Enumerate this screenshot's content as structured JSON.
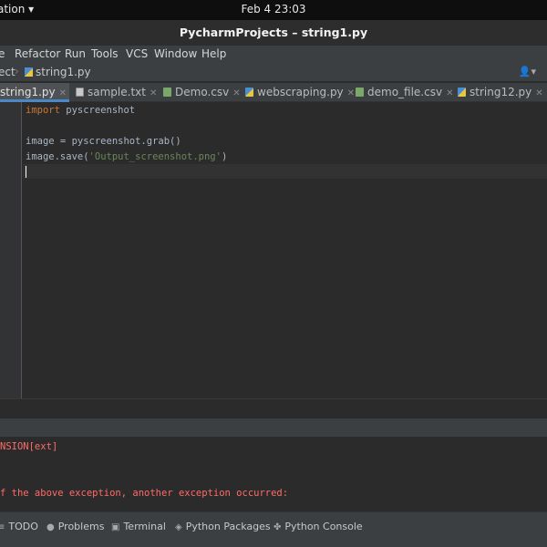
{
  "topbar": {
    "activities": "ation ▾",
    "clock": "Feb 4  23:03"
  },
  "window": {
    "title": "PycharmProjects – string1.py"
  },
  "menu": [
    "e",
    "Refactor",
    "Run",
    "Tools",
    "VCS",
    "Window",
    "Help"
  ],
  "breadcrumb": {
    "project": "ect",
    "file": "string1.py"
  },
  "tabs": [
    {
      "label": "string1.py",
      "active": true,
      "icon": "python-file-icon"
    },
    {
      "label": "sample.txt",
      "active": false,
      "icon": "text-file-icon"
    },
    {
      "label": "Demo.csv",
      "active": false,
      "icon": "csv-file-icon"
    },
    {
      "label": "webscraping.py",
      "active": false,
      "icon": "python-file-icon"
    },
    {
      "label": "demo_file.csv",
      "active": false,
      "icon": "csv-file-icon"
    },
    {
      "label": "string12.py",
      "active": false,
      "icon": "python-file-icon"
    }
  ],
  "code": {
    "l1_kw": "import",
    "l1_rest": " pyscreenshot",
    "l3": "image = pyscreenshot.grab()",
    "l4_pre": "image.save(",
    "l4_str": "'Output_screenshot.png'",
    "l4_post": ")"
  },
  "console": {
    "line1": "NSION[ext]",
    "line2": "f the above exception, another exception occurred:"
  },
  "bottom_tools": [
    {
      "label": "TODO",
      "icon": "list-icon"
    },
    {
      "label": "Problems",
      "icon": "info-icon"
    },
    {
      "label": "Terminal",
      "icon": "terminal-icon"
    },
    {
      "label": "Python Packages",
      "icon": "layers-icon"
    },
    {
      "label": "Python Console",
      "icon": "python-icon"
    }
  ],
  "colors": {
    "keyword": "#cc7832",
    "string": "#6a8759",
    "error": "#ff6b68",
    "accent": "#4a88c7"
  }
}
